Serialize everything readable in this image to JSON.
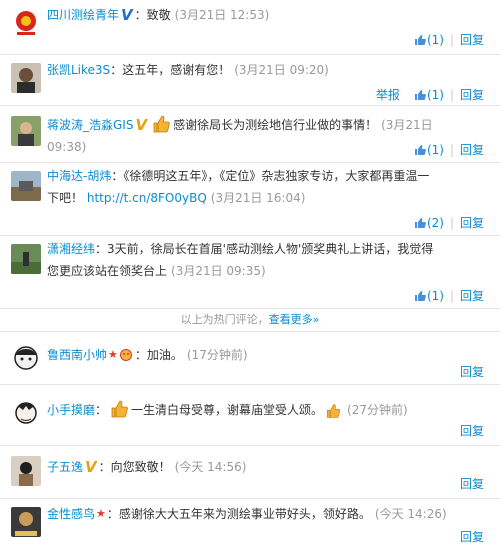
{
  "comments": [
    {
      "user": "四川测绘青年",
      "badge": "V",
      "text": "：致敬",
      "time": "(3月21日 12:53)",
      "likes": "(1)",
      "reply": "回复",
      "report": ""
    },
    {
      "user": "张凯Like3S",
      "badge": "",
      "text": "：这五年，感谢有您！",
      "time": "(3月21日 09:20)",
      "likes": "(1)",
      "reply": "回复",
      "report": "举报"
    },
    {
      "user": "蒋波涛_浩淼GIS",
      "badge": "V",
      "text": "感谢徐局长为测绘地信行业做的事情！",
      "time": "(3月21日 09:38)",
      "likes": "(1)",
      "reply": "回复",
      "report": ""
    },
    {
      "user": "中海达-胡炜",
      "badge": "",
      "text": "：《徐德明这五年》，《定位》杂志独家专访，大家都再重温一下吧！",
      "link": "http://t.cn/8FO0yBQ",
      "time": "(3月21日 16:04)",
      "likes": "(2)",
      "reply": "回复",
      "report": ""
    },
    {
      "user": "潇湘经纬",
      "badge": "",
      "text": "：3天前，徐局长在首届'感动测绘人物'颁奖典礼上讲话，我觉得您更应该站在领奖台上",
      "time": "(3月21日 09:35)",
      "likes": "(1)",
      "reply": "回复",
      "report": ""
    }
  ],
  "divider": {
    "text": "以上为热门评论，",
    "more": "查看更多»"
  },
  "recent": [
    {
      "user": "鲁西南小帅",
      "text": "：加油。",
      "time": "(17分钟前)",
      "reply": "回复"
    },
    {
      "user": "小手摸磨",
      "text": "一生清白母受尊，谢幕庙堂受人颂。",
      "time": "(27分钟前)",
      "reply": "回复"
    },
    {
      "user": "子五逸",
      "badge": "V",
      "text": "：向您致敬！",
      "time": "(今天 14:56)",
      "reply": "回复"
    },
    {
      "user": "金性感鸟",
      "text": "：感谢徐大大五年来为测绘事业带好头，领好路。",
      "time": "(今天 14:26)",
      "reply": "回复"
    }
  ],
  "colors": {
    "link": "#0a8cd2",
    "time": "#999999",
    "vip": "#e6a10b"
  }
}
